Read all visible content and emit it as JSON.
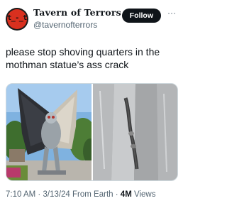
{
  "tweet": {
    "author": {
      "display_name": "Tavern of Terrors",
      "handle": "@tavernofterrors",
      "avatar_text": "t_-_t"
    },
    "follow_label": "Follow",
    "more_label": "···",
    "text": "please stop shoving quarters in the mothman statue’s ass crack",
    "media": [
      {
        "description_icon": "mothman-statue-photo"
      },
      {
        "description_icon": "coin-crack-closeup-photo"
      }
    ],
    "time": "7:10 AM",
    "sep1": "·",
    "date": "3/13/24",
    "source": "From Earth",
    "sep2": "·",
    "views_count": "4M",
    "views_label": "Views"
  },
  "colors": {
    "follow_bg": "#0f1419",
    "secondary_text": "#536471",
    "avatar_red": "#d9301f"
  }
}
